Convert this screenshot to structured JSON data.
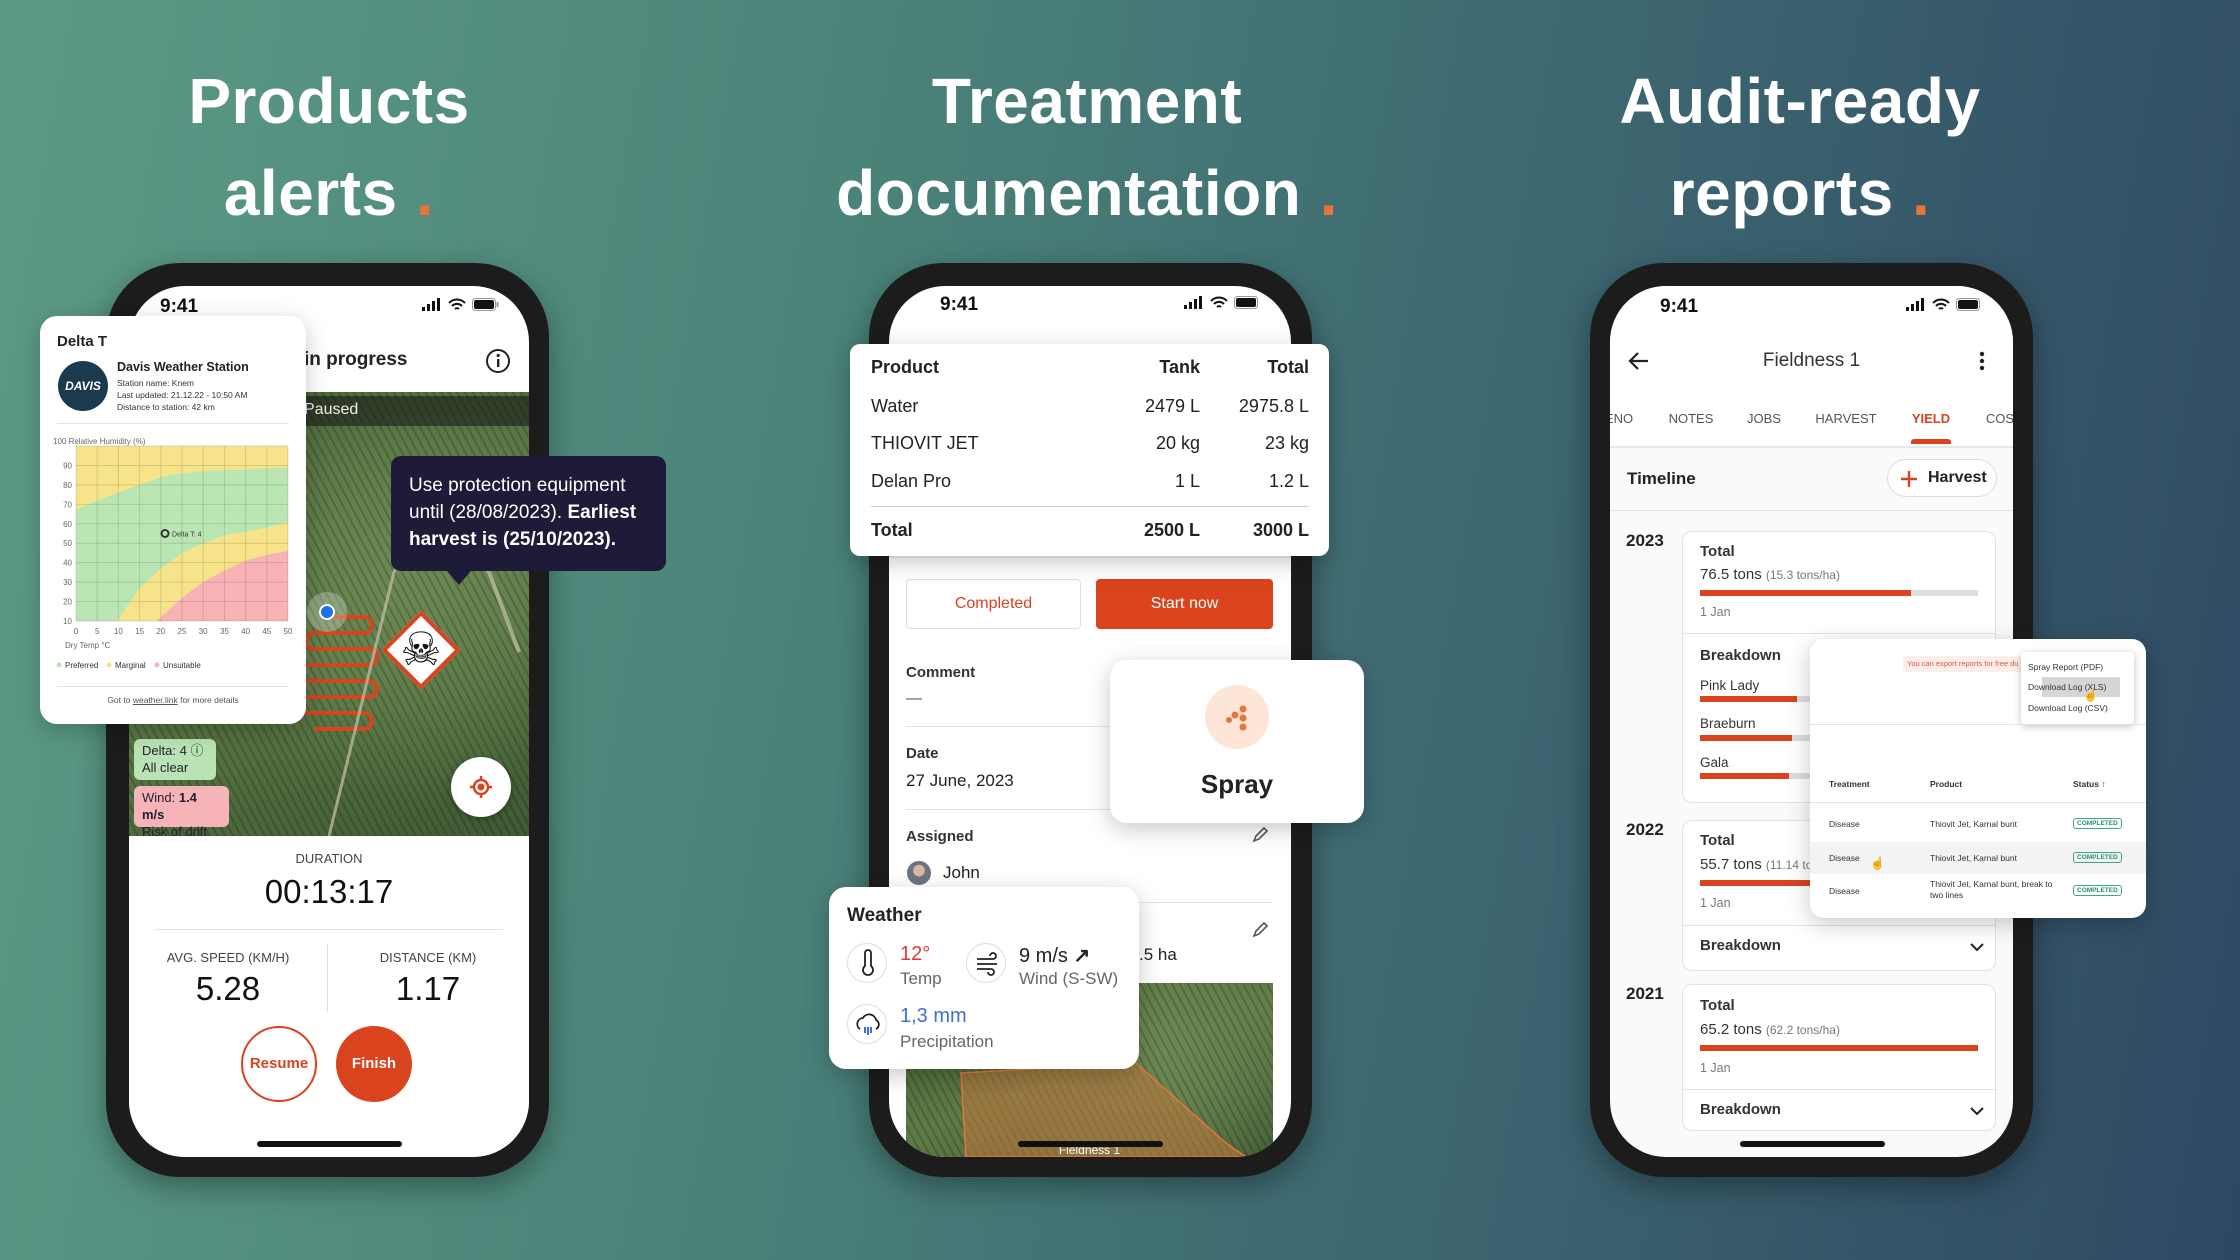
{
  "headlines": [
    {
      "line1": "Products",
      "line2": "alerts",
      "dot": "."
    },
    {
      "line1": "Treatment",
      "line2": "documentation",
      "dot": "."
    },
    {
      "line1": "Audit-ready",
      "line2": "reports",
      "dot": "."
    }
  ],
  "colors": {
    "accent": "#d9431e",
    "dot": "#e8743b",
    "tooltip": "#1e1b38",
    "preferred": "#b9e6b3",
    "marginal": "#f7e38a",
    "unsuitable": "#f7b3b5",
    "completed_badge": "#3aa88a",
    "precip": "#3b6fd6",
    "temp": "#e2343a"
  },
  "phone1": {
    "time": "9:41",
    "header_title": "in progress",
    "info_icon": "info-icon",
    "paused": "Paused",
    "tooltip": {
      "text": "Use protection equipment until (28/08/2023).",
      "bold": "Earliest harvest is (25/10/2023)."
    },
    "delta_badge": {
      "line1": "Delta: 4",
      "line2": "All clear"
    },
    "wind_badge": {
      "label": "Wind: ",
      "value": "1.4 m/s",
      "line2": "Risk of drift"
    },
    "duration_label": "DURATION",
    "duration": "00:13:17",
    "speed_label": "AVG. SPEED (KM/H)",
    "speed": "5.28",
    "distance_label": "DISTANCE (KM)",
    "distance": "1.17",
    "resume": "Resume",
    "finish": "Finish"
  },
  "delta_card": {
    "title": "Delta T",
    "logo": "DAVIS",
    "station": "Davis Weather Station",
    "station_name": "Station name: Knem",
    "last_updated": "Last updated: 21.12.22 - 10:50 AM",
    "distance": "Distance to station: 42 km",
    "footer_prefix": "Got to ",
    "footer_link": "weather.link",
    "footer_suffix": " for more details"
  },
  "chart_data": {
    "type": "area",
    "ylabel": "Relative Humidity (%)",
    "xlabel": "Dry Temp °C",
    "xlim": [
      0,
      50
    ],
    "ylim": [
      10,
      100
    ],
    "xticks": [
      0,
      5,
      10,
      15,
      20,
      25,
      30,
      35,
      40,
      45,
      50
    ],
    "yticks": [
      10,
      20,
      30,
      40,
      50,
      60,
      70,
      80,
      90,
      100
    ],
    "grid": true,
    "legend": [
      "Preferred",
      "Marginal",
      "Unsuitable"
    ],
    "legend_placement": "bottom",
    "boundaries": {
      "upper_marginal_preferred": {
        "x": [
          0,
          5,
          10,
          15,
          20,
          25,
          30,
          40,
          50
        ],
        "y": [
          67,
          72,
          76,
          80,
          84,
          86,
          87,
          88,
          89
        ]
      },
      "preferred_marginal_lower": {
        "x": [
          9,
          10,
          15,
          20,
          25,
          30,
          35,
          40,
          45,
          50
        ],
        "y": [
          10,
          11,
          27,
          37,
          45,
          50,
          54,
          56,
          58,
          61
        ]
      },
      "marginal_unsuitable": {
        "x": [
          19,
          25,
          30,
          35,
          40,
          45,
          50
        ],
        "y": [
          10,
          22,
          30,
          36,
          41,
          44,
          46
        ]
      }
    },
    "point": {
      "x": 21,
      "y": 55,
      "label": "Delta T: 4"
    }
  },
  "phone2": {
    "time": "9:41",
    "table": {
      "headers": [
        "Product",
        "Tank",
        "Total"
      ],
      "rows": [
        [
          "Water",
          "2479 L",
          "2975.8 L"
        ],
        [
          "THIOVIT JET",
          "20 kg",
          "23 kg"
        ],
        [
          "Delan Pro",
          "1 L",
          "1.2 L"
        ]
      ],
      "total": [
        "Total",
        "2500 L",
        "3000 L"
      ]
    },
    "completed": "Completed",
    "start_now": "Start now",
    "comment_label": "Comment",
    "comment_value": "—",
    "date_label": "Date",
    "date_value": "27 June, 2023",
    "assigned_label": "Assigned",
    "assignee": "John",
    "area_partial": ".5 ha",
    "map_label": "Fieldness 1",
    "spray": "Spray",
    "weather": {
      "title": "Weather",
      "temp": "12°",
      "temp_label": "Temp",
      "wind": "9 m/s",
      "wind_arrow": "↗",
      "wind_label": "Wind (S-SW)",
      "precip": "1,3 mm",
      "precip_label": "Precipitation"
    }
  },
  "phone3": {
    "time": "9:41",
    "title": "Fieldness 1",
    "tabs": [
      "ENO",
      "NOTES",
      "JOBS",
      "HARVEST",
      "YIELD",
      "COS"
    ],
    "active_tab": "YIELD",
    "timeline": "Timeline",
    "harvest_button": "Harvest",
    "years": [
      {
        "year": "2023",
        "total_label": "Total",
        "tons": "76.5 tons",
        "per_ha": "(15.3 tons/ha)",
        "progress": 0.76,
        "date": "1 Jan",
        "breakdown": "Breakdown",
        "items": [
          {
            "name": "Pink Lady",
            "progress": 0.35
          },
          {
            "name": "Braeburn",
            "progress": 0.33
          },
          {
            "name": "Gala",
            "progress": 0.32
          }
        ]
      },
      {
        "year": "2022",
        "total_label": "Total",
        "tons": "55.7 tons",
        "per_ha": "(11.14 to",
        "progress": 0.56,
        "date": "1 Jan",
        "breakdown": "Breakdown"
      },
      {
        "year": "2021",
        "total_label": "Total",
        "tons": "65.2 tons",
        "per_ha": "(62.2 tons/ha)",
        "progress": 1.0,
        "date": "1 Jan",
        "breakdown": "Breakdown"
      }
    ]
  },
  "report_popup": {
    "banner": "You can export reports for free du",
    "menu": [
      "Spray Report (PDF)",
      "Download Log (XLS)",
      "Download Log (CSV)"
    ],
    "highlighted": "Download Log (XLS)",
    "headers": [
      "Treatment",
      "Product",
      "Status ↑"
    ],
    "rows": [
      [
        "Disease",
        "Thiovit Jet, Karnal bunt",
        "COMPLETED"
      ],
      [
        "Disease",
        "Thiovit Jet, Karnal bunt",
        "COMPLETED"
      ],
      [
        "Disease",
        "Thiovit Jet, Karnal bunt, break to two lines",
        "COMPLETED"
      ]
    ]
  }
}
